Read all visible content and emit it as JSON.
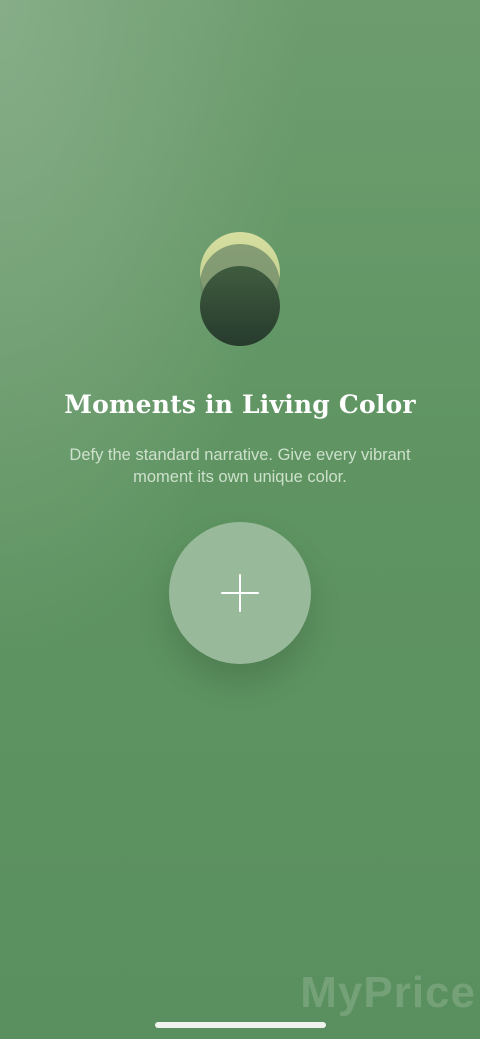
{
  "onboarding": {
    "headline": "Moments in Living Color",
    "subtitle": "Defy the standard narrative. Give every vibrant moment its own unique color.",
    "add_button_icon": "plus-icon"
  },
  "watermark": {
    "text": "MyPrice"
  },
  "colors": {
    "background": "#5f9462",
    "circle_top": "#d7dfa0",
    "circle_bottom": "#273b2d",
    "add_button": "#b6cdb6",
    "text_primary": "#ffffff"
  }
}
